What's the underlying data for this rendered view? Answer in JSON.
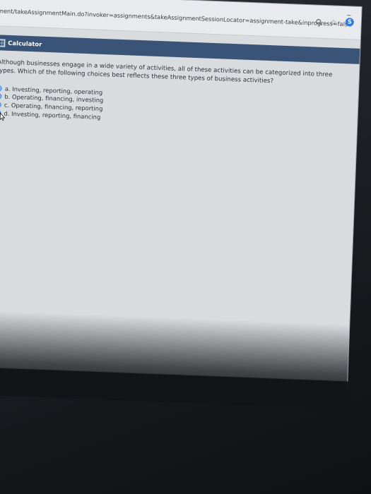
{
  "browser": {
    "url": "ment/takeAssignmentMain.do?invoker=assignments&takeAssignmentSessionLocator=assignment-take&inprogress=false",
    "minimize_label": "–",
    "ext_badge": "S"
  },
  "toolbar": {
    "calculator_label": "Calculator"
  },
  "question": {
    "text": "Although businesses engage in a wide variety of activities, all of these activities can be categorized into three types. Which of the following choices best reflects these three types of business activities?",
    "options": [
      {
        "label": "a. Investing, reporting, operating",
        "selected": false
      },
      {
        "label": "b. Operating, financing, investing",
        "selected": false
      },
      {
        "label": "c. Operating, financing, reporting",
        "selected": false
      },
      {
        "label": "d. Investing, reporting, financing",
        "selected": true
      }
    ]
  },
  "icons": [
    "search-icon",
    "star-icon",
    "extension-icon",
    "calculator-icon",
    "radio-icon",
    "cursor-icon"
  ],
  "colors": {
    "toolbar": "#3a5478",
    "radio": "#7fb2ff",
    "radio_selected_border": "#1e6fd9"
  }
}
